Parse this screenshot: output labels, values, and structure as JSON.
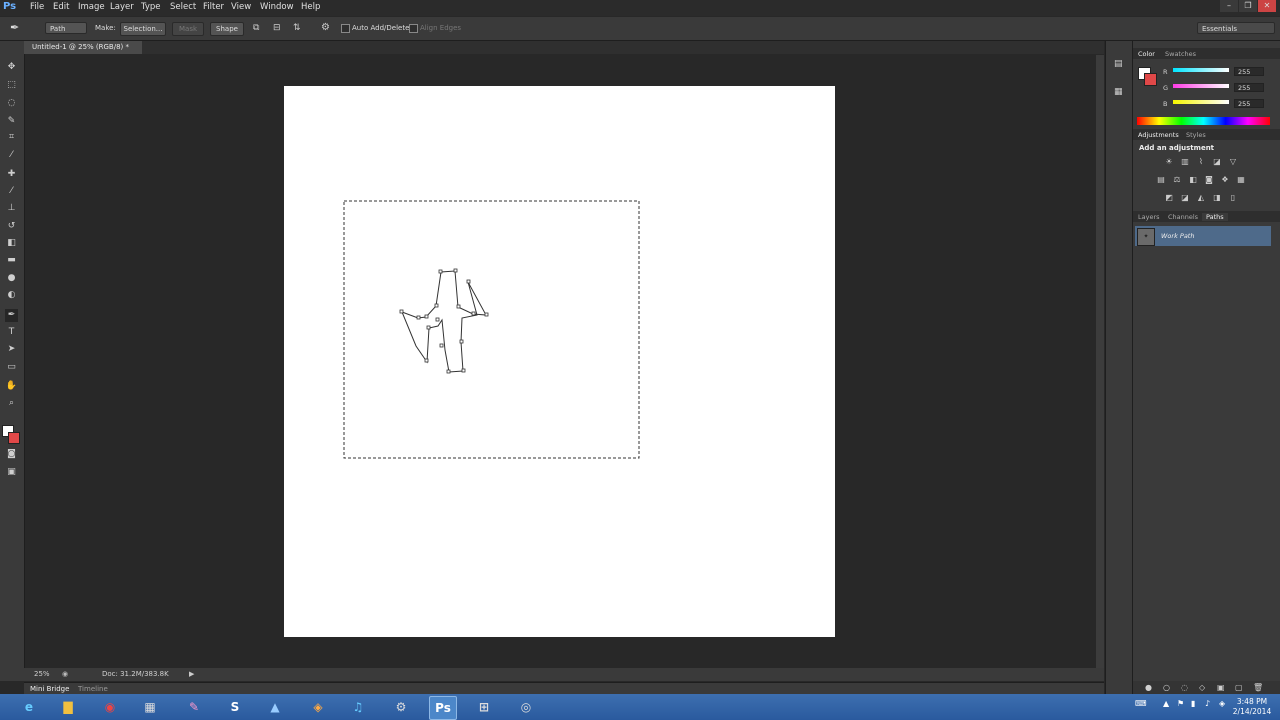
{
  "app": {
    "logo": "Ps"
  },
  "menu": [
    "File",
    "Edit",
    "Image",
    "Layer",
    "Type",
    "Select",
    "Filter",
    "View",
    "Window",
    "Help"
  ],
  "window_controls": {
    "minimize": "–",
    "restore": "❐",
    "close": "✕"
  },
  "options_bar": {
    "mode": "Path",
    "make_label": "Make:",
    "selection": "Selection...",
    "mask": "Mask",
    "shape": "Shape",
    "auto_add_delete": "Auto Add/Delete",
    "align_edges": "Align Edges",
    "workspace": "Essentials"
  },
  "document_tab": {
    "title": "Untitled-1 @ 25% (RGB/8) *",
    "close": "×"
  },
  "status_bar": {
    "zoom": "25%",
    "doc": "Doc: 31.2M/383.8K"
  },
  "bottom_panel": {
    "tabs": [
      "Mini Bridge",
      "Timeline"
    ]
  },
  "color_panel": {
    "tabs": [
      "Color",
      "Swatches"
    ],
    "channels": [
      {
        "label": "R",
        "value": "255",
        "color": "#00e5ff"
      },
      {
        "label": "G",
        "value": "255",
        "color": "#ff3ce6"
      },
      {
        "label": "B",
        "value": "255",
        "color": "#f5f500"
      }
    ]
  },
  "adjustments_panel": {
    "tabs": [
      "Adjustments",
      "Styles"
    ],
    "heading": "Add an adjustment"
  },
  "layers_panel": {
    "tabs": [
      "Layers",
      "Channels",
      "Paths"
    ],
    "active_tab": "Paths",
    "item": "Work Path"
  },
  "taskbar": {
    "clock_time": "3:48 PM",
    "clock_date": "2/14/2014",
    "ps_label": "Ps"
  }
}
